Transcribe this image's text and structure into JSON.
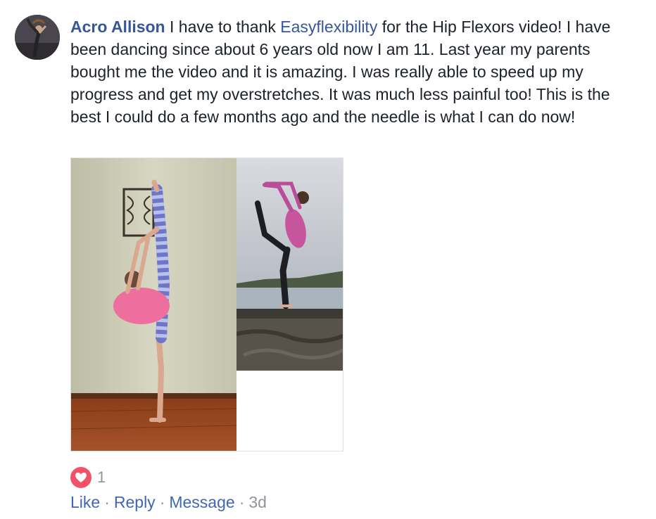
{
  "comment": {
    "author": "Acro Allison",
    "text_before_tag": " I have to thank ",
    "tagged_page": "Easyflexibility",
    "text_after_tag": " for the Hip Flexors video! I have been dancing since about 6 years old now I am 11. Last year my parents bought me the video and it is amazing. I was really able to speed up my progress and get my overstretches. It was much less painful too! This is the best I could do a few months ago and the needle is what I can do now!"
  },
  "reactions": {
    "type": "heart-icon",
    "count": "1",
    "color": "#f25268"
  },
  "actions": {
    "like_label": "Like",
    "reply_label": "Reply",
    "message_label": "Message",
    "separator": "·",
    "timestamp": "3d"
  },
  "colors": {
    "link": "#365899",
    "action": "#4267b2",
    "muted": "#90949c"
  }
}
